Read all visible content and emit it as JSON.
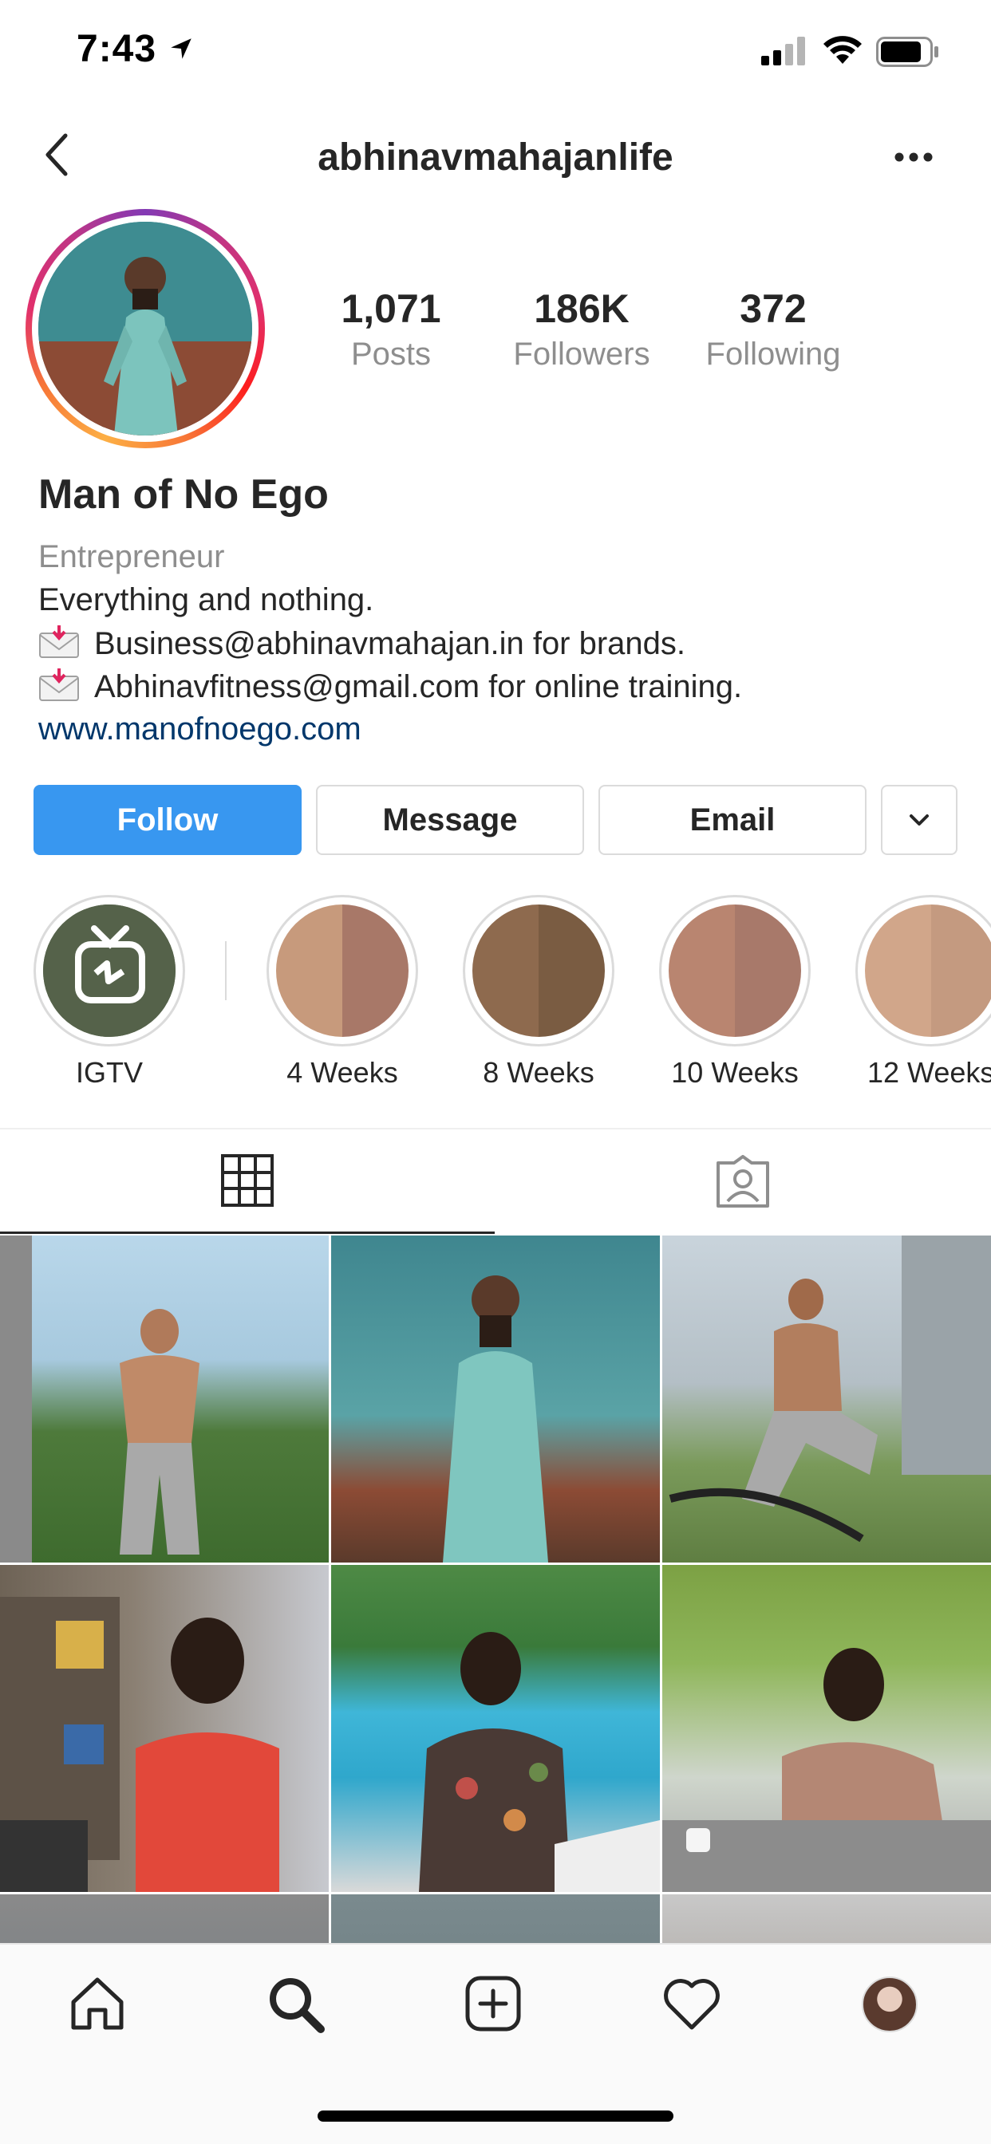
{
  "status_bar": {
    "time": "7:43"
  },
  "nav": {
    "username": "abhinavmahajanlife"
  },
  "profile": {
    "stats": [
      {
        "value": "1,071",
        "label": "Posts"
      },
      {
        "value": "186K",
        "label": "Followers"
      },
      {
        "value": "372",
        "label": "Following"
      }
    ],
    "full_name": "Man of No Ego",
    "category": "Entrepreneur",
    "bio_line1": "Everything and nothing.",
    "bio_line2": "Business@abhinavmahajan.in for brands.",
    "bio_line3": "Abhinavfitness@gmail.com for online training.",
    "website": "www.manofnoego.com"
  },
  "actions": {
    "follow": "Follow",
    "message": "Message",
    "email": "Email"
  },
  "highlights": [
    {
      "label": "IGTV"
    },
    {
      "label": "4 Weeks"
    },
    {
      "label": "8 Weeks"
    },
    {
      "label": "10 Weeks"
    },
    {
      "label": "12 Weeks"
    }
  ],
  "colors": {
    "follow_button": "#3897f0",
    "link": "#00376b",
    "secondary_text": "#8e8e8e",
    "primary_text": "#262626"
  },
  "icons": {
    "tabs": [
      "grid-icon",
      "tagged-person-icon"
    ],
    "bottom_nav": [
      "home-icon",
      "search-icon",
      "new-post-icon",
      "activity-heart-icon",
      "profile-avatar-icon"
    ]
  }
}
